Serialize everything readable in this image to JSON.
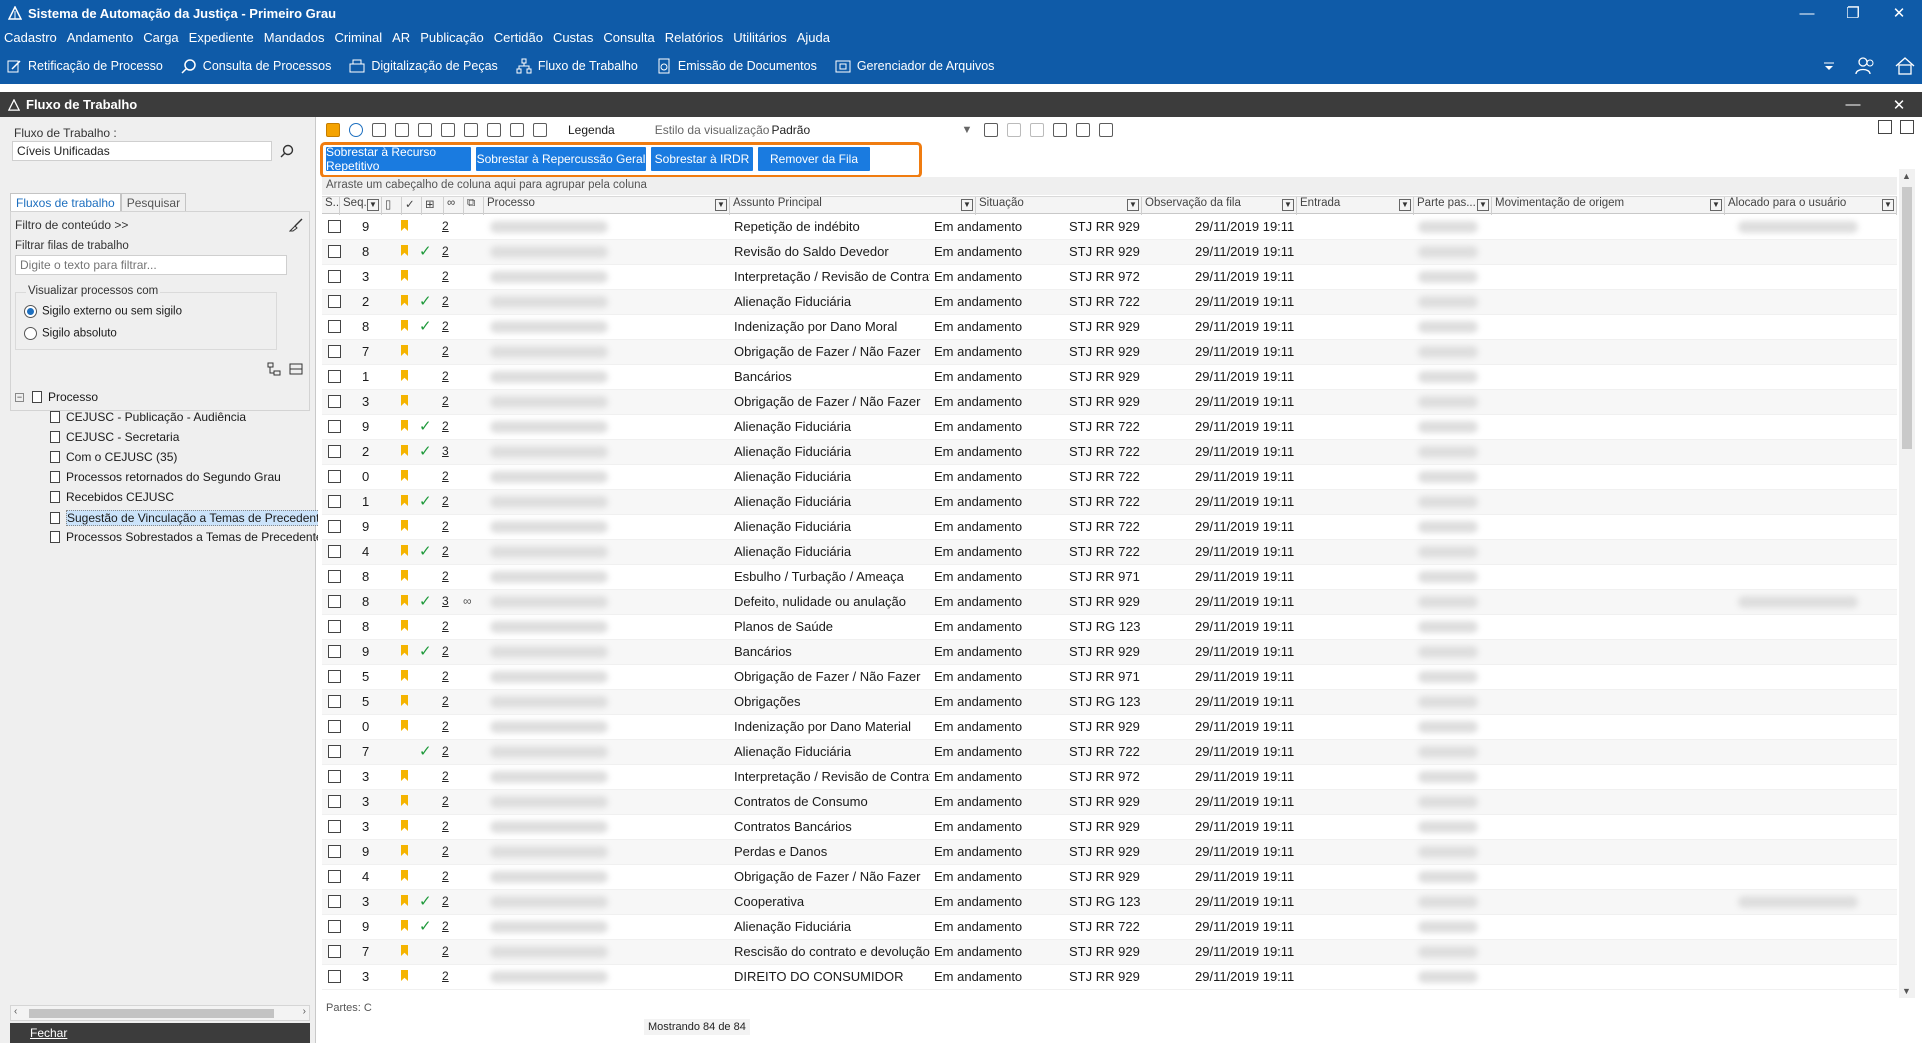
{
  "window": {
    "title": "Sistema de Automação da Justiça - Primeiro Grau",
    "controls": [
      "—",
      "❐",
      "✕"
    ]
  },
  "menu": [
    "Cadastro",
    "Andamento",
    "Carga",
    "Expediente",
    "Mandados",
    "Criminal",
    "AR",
    "Publicação",
    "Certidão",
    "Custas",
    "Consulta",
    "Relatórios",
    "Utilitários",
    "Ajuda"
  ],
  "toolbar": {
    "buttons": [
      {
        "label": "Retificação de Processo",
        "icon": "edit-icon"
      },
      {
        "label": "Consulta de Processos",
        "icon": "search-icon"
      },
      {
        "label": "Digitalização de Peças",
        "icon": "scanner-icon"
      },
      {
        "label": "Fluxo de Trabalho",
        "icon": "workflow-icon"
      },
      {
        "label": "Emissão de Documentos",
        "icon": "document-icon"
      },
      {
        "label": "Gerenciador de Arquivos",
        "icon": "folder-icon"
      }
    ]
  },
  "child_window": {
    "title": "Fluxo de Trabalho"
  },
  "left_panel": {
    "fluxo_label": "Fluxo de Trabalho :",
    "fluxo_value": "Cíveis Unificadas",
    "tabs": [
      "Fluxos de trabalho",
      "Pesquisar"
    ],
    "filtro_conteudo": "Filtro de conteúdo >>",
    "filtrar_label": "Filtrar filas de trabalho",
    "filtrar_placeholder": "Digite o texto para filtrar...",
    "visualizar_label": "Visualizar processos com",
    "radio_options": [
      {
        "label": "Sigilo externo ou sem sigilo",
        "selected": true
      },
      {
        "label": "Sigilo absoluto",
        "selected": false
      }
    ],
    "tree_root": "Processo",
    "tree_items": [
      {
        "label": "CEJUSC - Publicação - Audiência",
        "selected": false
      },
      {
        "label": "CEJUSC - Secretaria",
        "selected": false
      },
      {
        "label": "Com o CEJUSC (35)",
        "selected": false
      },
      {
        "label": "Processos retornados do Segundo Grau",
        "selected": false
      },
      {
        "label": "Recebidos CEJUSC",
        "selected": false
      },
      {
        "label": "Sugestão de Vinculação a Temas de Precedent",
        "selected": true
      },
      {
        "label": "Processos Sobrestados a Temas de Precedente",
        "selected": false
      }
    ],
    "close_label": "Fechar"
  },
  "main": {
    "legenda": "Legenda",
    "estilo_label": "Estilo da visualização",
    "estilo_value": "Padrão",
    "actions": [
      "Sobrestar à Recurso Repetitivo",
      "Sobrestar à Repercussão Geral",
      "Sobrestar à IRDR",
      "Remover da Fila"
    ],
    "accent_color": "#f07c10",
    "action_color": "#1a7be0",
    "group_hint": "Arraste um cabeçalho de coluna aqui para agrupar pela coluna",
    "columns": [
      "S...",
      "Seq.",
      "",
      "",
      "",
      "",
      "",
      "Processo",
      "Assunto Principal",
      "Situação",
      "Observação da fila",
      "Entrada",
      "Parte pas...",
      "Movimentação de origem",
      "Alocado para o usuário"
    ],
    "rows": [
      {
        "seq": "9",
        "mark": true,
        "check": false,
        "link": "2",
        "chain": false,
        "assunto": "Repetição de indébito",
        "situacao": "Em andamento",
        "obs": "STJ RR 929",
        "entrada": "29/11/2019 19:11"
      },
      {
        "seq": "8",
        "mark": true,
        "check": true,
        "link": "2",
        "chain": false,
        "assunto": "Revisão do Saldo Devedor",
        "situacao": "Em andamento",
        "obs": "STJ RR 929",
        "entrada": "29/11/2019 19:11"
      },
      {
        "seq": "3",
        "mark": true,
        "check": false,
        "link": "2",
        "chain": false,
        "assunto": "Interpretação / Revisão de Contrato",
        "situacao": "Em andamento",
        "obs": "STJ RR 972",
        "entrada": "29/11/2019 19:11"
      },
      {
        "seq": "2",
        "mark": true,
        "check": true,
        "link": "2",
        "chain": false,
        "assunto": "Alienação Fiduciária",
        "situacao": "Em andamento",
        "obs": "STJ RR 722",
        "entrada": "29/11/2019 19:11"
      },
      {
        "seq": "8",
        "mark": true,
        "check": true,
        "link": "2",
        "chain": false,
        "assunto": "Indenização por Dano Moral",
        "situacao": "Em andamento",
        "obs": "STJ RR 929",
        "entrada": "29/11/2019 19:11"
      },
      {
        "seq": "7",
        "mark": true,
        "check": false,
        "link": "2",
        "chain": false,
        "assunto": "Obrigação de Fazer / Não Fazer",
        "situacao": "Em andamento",
        "obs": "STJ RR 929",
        "entrada": "29/11/2019 19:11"
      },
      {
        "seq": "1",
        "mark": true,
        "check": false,
        "link": "2",
        "chain": false,
        "assunto": "Bancários",
        "situacao": "Em andamento",
        "obs": "STJ RR 929",
        "entrada": "29/11/2019 19:11"
      },
      {
        "seq": "3",
        "mark": true,
        "check": false,
        "link": "2",
        "chain": false,
        "assunto": "Obrigação de Fazer / Não Fazer",
        "situacao": "Em andamento",
        "obs": "STJ RR 929",
        "entrada": "29/11/2019 19:11"
      },
      {
        "seq": "9",
        "mark": true,
        "check": true,
        "link": "2",
        "chain": false,
        "assunto": "Alienação Fiduciária",
        "situacao": "Em andamento",
        "obs": "STJ RR 722",
        "entrada": "29/11/2019 19:11"
      },
      {
        "seq": "2",
        "mark": true,
        "check": true,
        "link": "3",
        "chain": false,
        "assunto": "Alienação Fiduciária",
        "situacao": "Em andamento",
        "obs": "STJ RR 722",
        "entrada": "29/11/2019 19:11"
      },
      {
        "seq": "0",
        "mark": true,
        "check": false,
        "link": "2",
        "chain": false,
        "assunto": "Alienação Fiduciária",
        "situacao": "Em andamento",
        "obs": "STJ RR 722",
        "entrada": "29/11/2019 19:11"
      },
      {
        "seq": "1",
        "mark": true,
        "check": true,
        "link": "2",
        "chain": false,
        "assunto": "Alienação Fiduciária",
        "situacao": "Em andamento",
        "obs": "STJ RR 722",
        "entrada": "29/11/2019 19:11"
      },
      {
        "seq": "9",
        "mark": true,
        "check": false,
        "link": "2",
        "chain": false,
        "assunto": "Alienação Fiduciária",
        "situacao": "Em andamento",
        "obs": "STJ RR 722",
        "entrada": "29/11/2019 19:11"
      },
      {
        "seq": "4",
        "mark": true,
        "check": true,
        "link": "2",
        "chain": false,
        "assunto": "Alienação Fiduciária",
        "situacao": "Em andamento",
        "obs": "STJ RR 722",
        "entrada": "29/11/2019 19:11"
      },
      {
        "seq": "8",
        "mark": true,
        "check": false,
        "link": "2",
        "chain": false,
        "assunto": "Esbulho / Turbação / Ameaça",
        "situacao": "Em andamento",
        "obs": "STJ RR 971",
        "entrada": "29/11/2019 19:11"
      },
      {
        "seq": "8",
        "mark": true,
        "check": true,
        "link": "3",
        "chain": true,
        "assunto": "Defeito, nulidade ou anulação",
        "situacao": "Em andamento",
        "obs": "STJ RR 929",
        "entrada": "29/11/2019 19:11"
      },
      {
        "seq": "8",
        "mark": true,
        "check": false,
        "link": "2",
        "chain": false,
        "assunto": "Planos de Saúde",
        "situacao": "Em andamento",
        "obs": "STJ RG 123",
        "entrada": "29/11/2019 19:11"
      },
      {
        "seq": "9",
        "mark": true,
        "check": true,
        "link": "2",
        "chain": false,
        "assunto": "Bancários",
        "situacao": "Em andamento",
        "obs": "STJ RR 929",
        "entrada": "29/11/2019 19:11"
      },
      {
        "seq": "5",
        "mark": true,
        "check": false,
        "link": "2",
        "chain": false,
        "assunto": "Obrigação de Fazer / Não Fazer",
        "situacao": "Em andamento",
        "obs": "STJ RR 971",
        "entrada": "29/11/2019 19:11"
      },
      {
        "seq": "5",
        "mark": true,
        "check": false,
        "link": "2",
        "chain": false,
        "assunto": "Obrigações",
        "situacao": "Em andamento",
        "obs": "STJ RG 123",
        "entrada": "29/11/2019 19:11"
      },
      {
        "seq": "0",
        "mark": true,
        "check": false,
        "link": "2",
        "chain": false,
        "assunto": "Indenização por Dano Material",
        "situacao": "Em andamento",
        "obs": "STJ RR 929",
        "entrada": "29/11/2019 19:11"
      },
      {
        "seq": "7",
        "mark": false,
        "check": true,
        "link": "2",
        "chain": false,
        "assunto": "Alienação Fiduciária",
        "situacao": "Em andamento",
        "obs": "STJ RR 722",
        "entrada": "29/11/2019 19:11"
      },
      {
        "seq": "3",
        "mark": true,
        "check": false,
        "link": "2",
        "chain": false,
        "assunto": "Interpretação / Revisão de Contrato",
        "situacao": "Em andamento",
        "obs": "STJ RR 972",
        "entrada": "29/11/2019 19:11"
      },
      {
        "seq": "3",
        "mark": true,
        "check": false,
        "link": "2",
        "chain": false,
        "assunto": "Contratos de Consumo",
        "situacao": "Em andamento",
        "obs": "STJ RR 929",
        "entrada": "29/11/2019 19:11"
      },
      {
        "seq": "3",
        "mark": true,
        "check": false,
        "link": "2",
        "chain": false,
        "assunto": "Contratos Bancários",
        "situacao": "Em andamento",
        "obs": "STJ RR 929",
        "entrada": "29/11/2019 19:11"
      },
      {
        "seq": "9",
        "mark": true,
        "check": false,
        "link": "2",
        "chain": false,
        "assunto": "Perdas e Danos",
        "situacao": "Em andamento",
        "obs": "STJ RR 929",
        "entrada": "29/11/2019 19:11"
      },
      {
        "seq": "4",
        "mark": true,
        "check": false,
        "link": "2",
        "chain": false,
        "assunto": "Obrigação de Fazer / Não Fazer",
        "situacao": "Em andamento",
        "obs": "STJ RR 929",
        "entrada": "29/11/2019 19:11"
      },
      {
        "seq": "3",
        "mark": true,
        "check": true,
        "link": "2",
        "chain": false,
        "assunto": "Cooperativa",
        "situacao": "Em andamento",
        "obs": "STJ RG 123",
        "entrada": "29/11/2019 19:11"
      },
      {
        "seq": "9",
        "mark": true,
        "check": true,
        "link": "2",
        "chain": false,
        "assunto": "Alienação Fiduciária",
        "situacao": "Em andamento",
        "obs": "STJ RR 722",
        "entrada": "29/11/2019 19:11"
      },
      {
        "seq": "7",
        "mark": true,
        "check": false,
        "link": "2",
        "chain": false,
        "assunto": "Rescisão do contrato e devolução do din",
        "situacao": "Em andamento",
        "obs": "STJ RR 929",
        "entrada": "29/11/2019 19:11"
      },
      {
        "seq": "3",
        "mark": true,
        "check": false,
        "link": "2",
        "chain": false,
        "assunto": "DIREITO DO CONSUMIDOR",
        "situacao": "Em andamento",
        "obs": "STJ RR 929",
        "entrada": "29/11/2019 19:11"
      }
    ],
    "partes_label": "Partes: C",
    "status": "Mostrando 84 de 84"
  }
}
